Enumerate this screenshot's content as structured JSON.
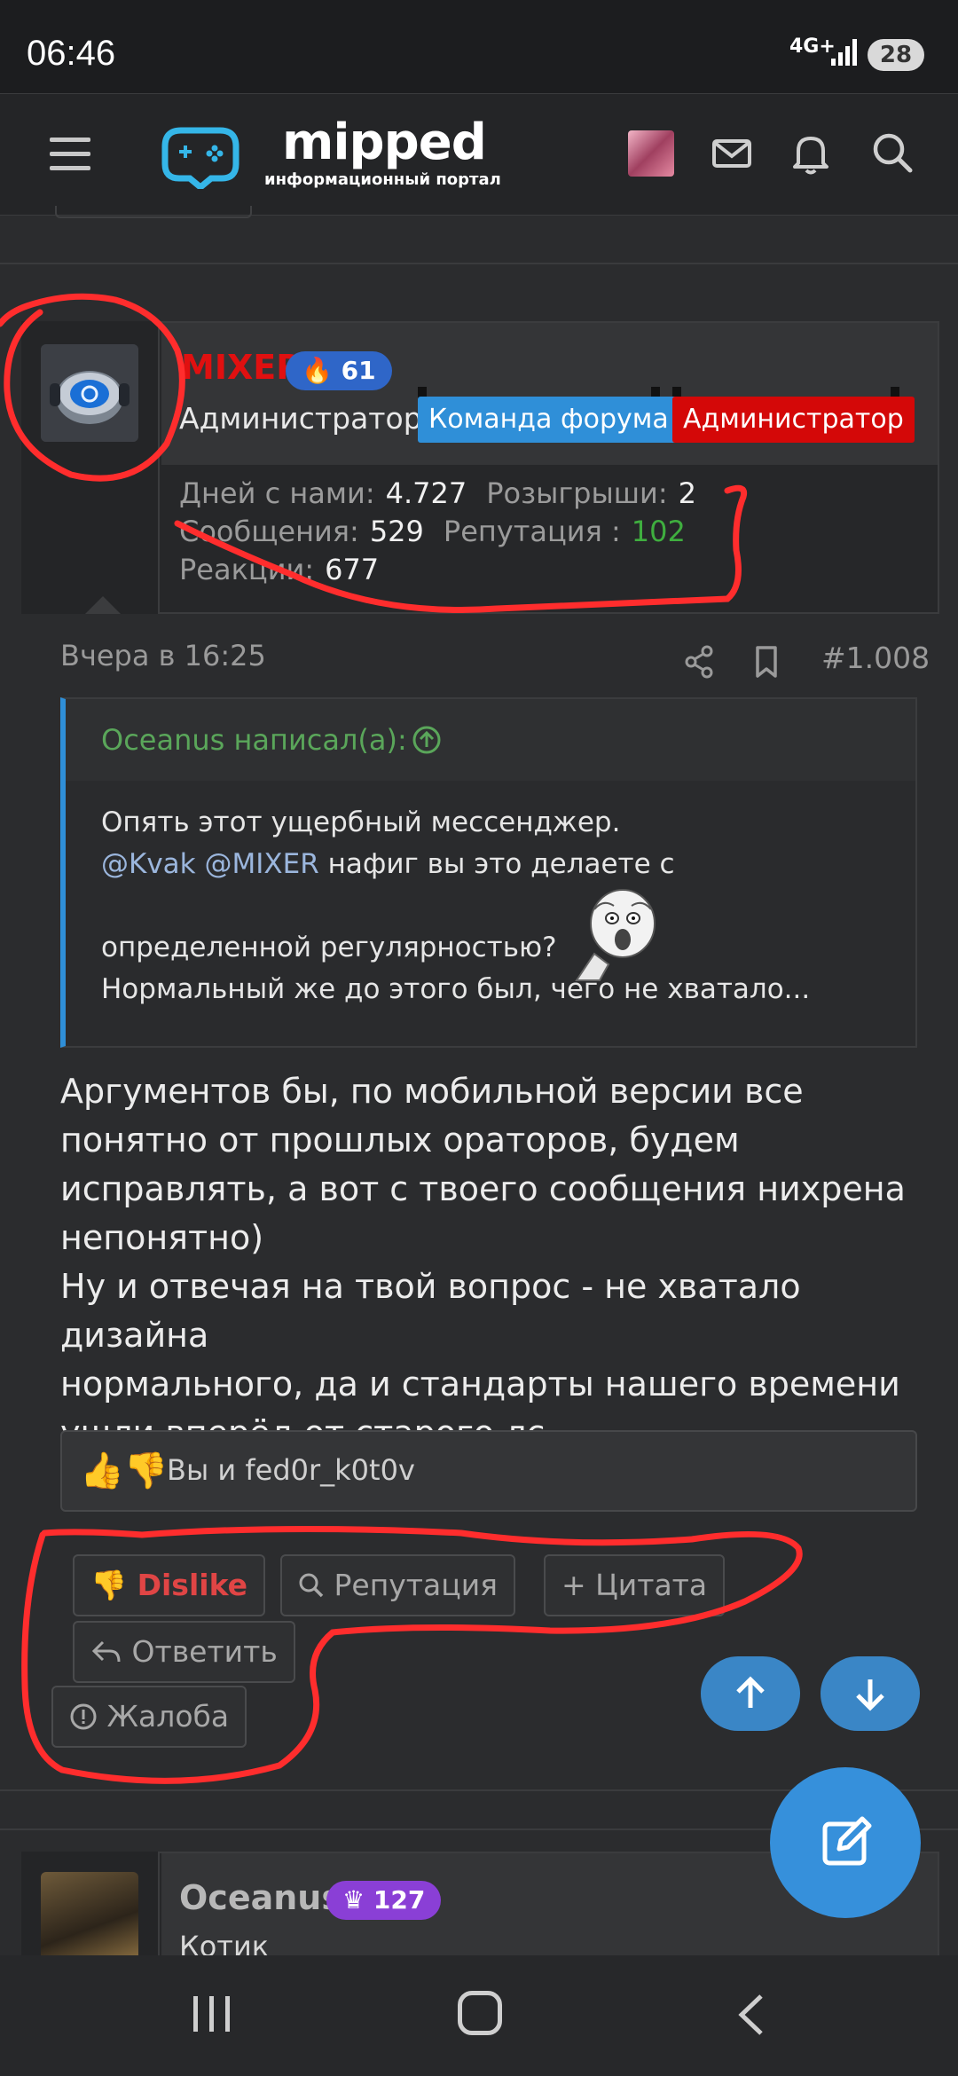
{
  "status_bar": {
    "time": "06:46",
    "network": "4G+",
    "battery": "28"
  },
  "header": {
    "logo_text": "mipped",
    "logo_subtitle": "информационный портал"
  },
  "post": {
    "author": {
      "name": "MIXER",
      "badge_count": "61",
      "title": "Администратор",
      "tags": [
        "Команда форума",
        "Администратор"
      ]
    },
    "stats": {
      "days_label": "Дней с нами:",
      "days_value": "4.727",
      "giveaways_label": "Розыгрыши:",
      "giveaways_value": "2",
      "messages_label": "Сообщения:",
      "messages_value": "529",
      "reputation_label": "Репутация :",
      "reputation_value": "102",
      "reactions_label": "Реакции:",
      "reactions_value": "677"
    },
    "date": "Вчера в 16:25",
    "number": "#1.008",
    "quote": {
      "author": "Oceanus написал(а):",
      "line1": "Опять этот ущербный мессенджер.",
      "mention1": "@Kvak",
      "mention2": "@MIXER",
      "line2_rest": " нафиг вы это делаете с",
      "line3": "определенной регулярностью?",
      "line4": "Нормальный же до этого был, чего не хватало..."
    },
    "body": [
      "Аргументов бы, по мобильной версии все",
      "понятно от прошлых ораторов, будем",
      "исправлять, а вот с твоего сообщения нихрена",
      "непонятно)",
      "Ну и отвечая на твой вопрос - не хватало дизайна",
      "нормального, да и стандарты нашего времени",
      "ушли вперёд от старого лс"
    ],
    "reactions": {
      "emoji": "👍👎",
      "text": "Вы и fed0r_k0t0v"
    },
    "actions": {
      "dislike": "Dislike",
      "reputation": "Репутация",
      "quote": "Цитата",
      "reply": "Ответить",
      "report": "Жалоба"
    }
  },
  "next_post": {
    "author": "Oceanus",
    "badge_count": "127",
    "title": "Котик"
  },
  "colors": {
    "admin_red": "#d40808",
    "team_blue": "#2f8fd8",
    "fab_blue": "#3690db",
    "scribble_red": "#ff2d2d"
  }
}
